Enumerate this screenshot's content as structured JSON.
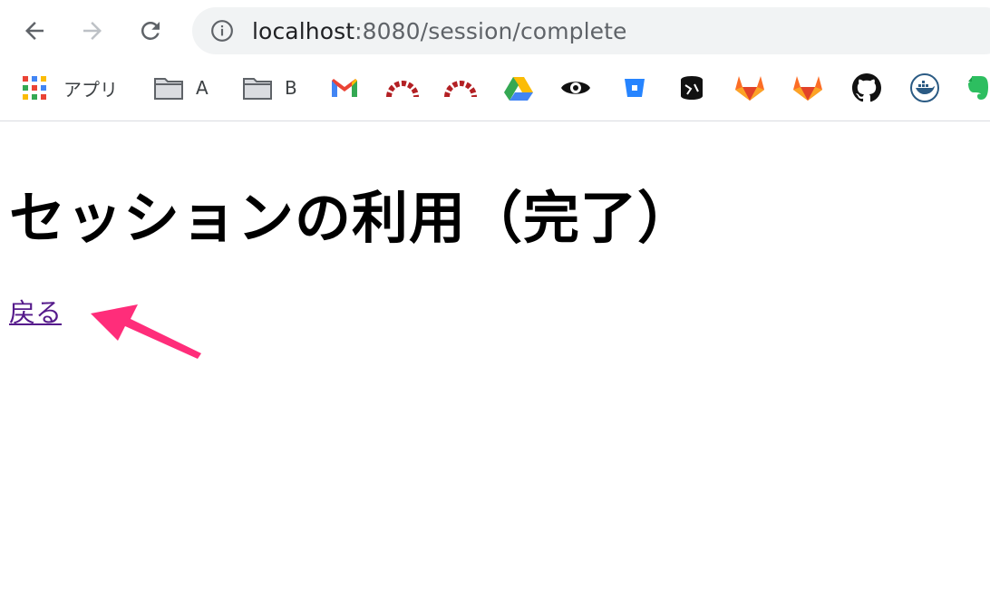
{
  "browser": {
    "url_host": "localhost",
    "url_rest": ":8080/session/complete"
  },
  "bookmarks": {
    "apps_label": "アプリ",
    "folder_a": "A",
    "folder_b": "B",
    "icons": [
      "gmail-icon",
      "redmine-icon",
      "redmine-icon",
      "google-drive-icon",
      "eye-icon",
      "bitbucket-icon",
      "site-icon",
      "gitlab-icon",
      "gitlab-icon",
      "github-icon",
      "docker-icon",
      "evernote-icon"
    ]
  },
  "page": {
    "title": "セッションの利用（完了）",
    "back_link": "戻る"
  },
  "colors": {
    "link": "#551a8b",
    "annotation_arrow": "#ff2d7a"
  }
}
